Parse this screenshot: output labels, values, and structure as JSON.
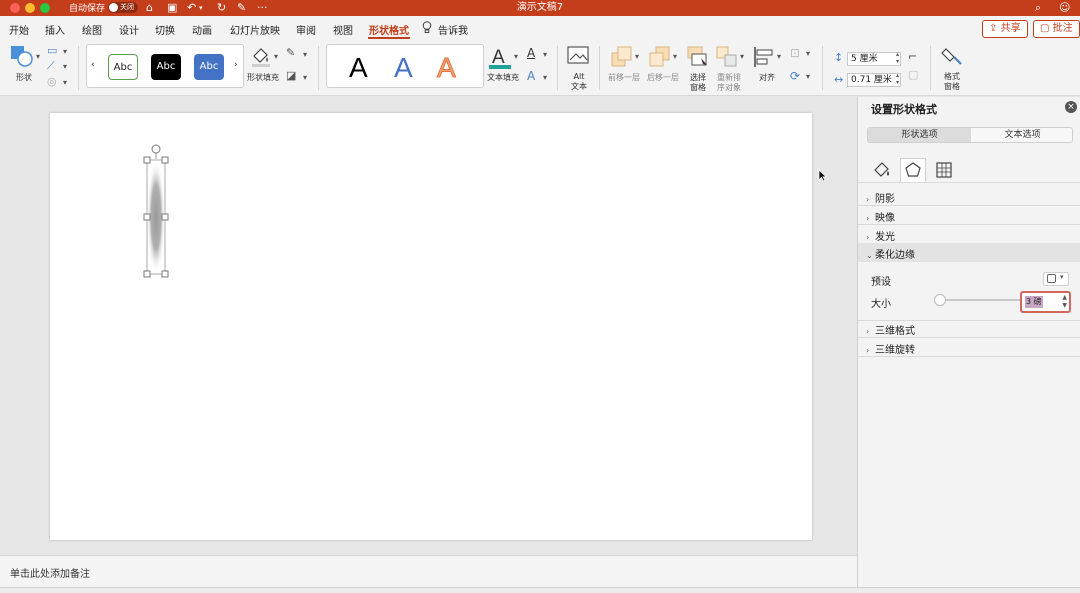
{
  "titlebar": {
    "autosave_label": "自动保存",
    "autosave_state": "关闭",
    "doc_title": "演示文稿7",
    "more": "···"
  },
  "tabs": [
    {
      "label": "开始"
    },
    {
      "label": "插入"
    },
    {
      "label": "绘图"
    },
    {
      "label": "设计"
    },
    {
      "label": "切换"
    },
    {
      "label": "动画"
    },
    {
      "label": "幻灯片放映"
    },
    {
      "label": "审阅"
    },
    {
      "label": "视图"
    },
    {
      "label": "形状格式",
      "active": true
    },
    {
      "label": "告诉我"
    }
  ],
  "top_buttons": {
    "share": "共享",
    "comment": "批注"
  },
  "ribbon": {
    "shape_label": "形状",
    "style_gallery": [
      "Abc",
      "Abc",
      "Abc"
    ],
    "shape_fill_label": "形状填充",
    "wordart_letter": "A",
    "text_fill_label": "文本填充",
    "alt_text_label": "Alt\n文本",
    "bring_forward_label": "前移一层",
    "send_backward_label": "后移一层",
    "selection_pane_label": "选择\n窗格",
    "reorder_label": "重新排\n序对象",
    "align_label": "对齐",
    "height_value": "5 厘米",
    "width_value": "0.71 厘米",
    "format_pane_label": "格式\n窗格"
  },
  "notes_placeholder": "单击此处添加备注",
  "format_pane": {
    "title": "设置形状格式",
    "segments": [
      "形状选项",
      "文本选项"
    ],
    "sections": [
      "阴影",
      "映像",
      "发光",
      "柔化边缘",
      "三维格式",
      "三维旋转"
    ],
    "expanded_section": "柔化边缘",
    "preset_label": "预设",
    "size_label": "大小",
    "size_value": "3 磅"
  },
  "colors": {
    "brand": "#c43e1c",
    "pane_bg": "#f3f3f3",
    "highlight_border": "#d1665a"
  }
}
